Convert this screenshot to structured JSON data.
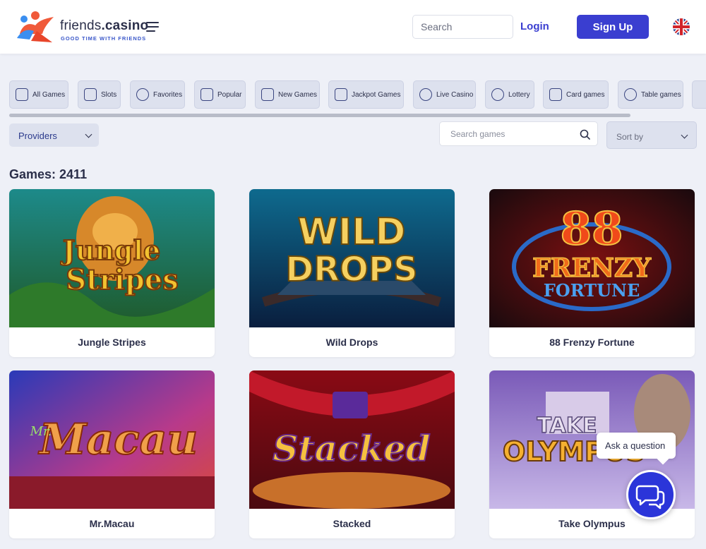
{
  "header": {
    "logo_text_main": "friends",
    "logo_text_bold": ".casino",
    "logo_tagline": "GOOD TIME WITH FRIENDS",
    "search_placeholder": "Search",
    "login_label": "Login",
    "signup_label": "Sign Up",
    "language_icon": "uk-flag-icon"
  },
  "categories": [
    {
      "label": "All Games",
      "icon": "all-games-icon"
    },
    {
      "label": "Slots",
      "icon": "slots-icon"
    },
    {
      "label": "Favorites",
      "icon": "favorites-icon"
    },
    {
      "label": "Popular",
      "icon": "popular-icon"
    },
    {
      "label": "New Games",
      "icon": "new-games-icon"
    },
    {
      "label": "Jackpot Games",
      "icon": "jackpot-icon"
    },
    {
      "label": "Live Casino",
      "icon": "live-casino-icon"
    },
    {
      "label": "Lottery",
      "icon": "lottery-icon"
    },
    {
      "label": "Card games",
      "icon": "card-games-icon"
    },
    {
      "label": "Table games",
      "icon": "table-games-icon"
    }
  ],
  "filters": {
    "providers_label": "Providers",
    "search_games_placeholder": "Search games",
    "sort_label": "Sort by"
  },
  "games": {
    "count_label": "Games: 2411",
    "items": [
      {
        "title": "Jungle Stripes"
      },
      {
        "title": "Wild Drops"
      },
      {
        "title": "88 Frenzy Fortune"
      },
      {
        "title": "Mr.Macau"
      },
      {
        "title": "Stacked"
      },
      {
        "title": "Take Olympus"
      }
    ]
  },
  "chat": {
    "bubble_text": "Ask a question"
  },
  "colors": {
    "accent": "#3a3ed0",
    "page_bg": "#eef0f7",
    "category_bg": "#dde1ee"
  }
}
